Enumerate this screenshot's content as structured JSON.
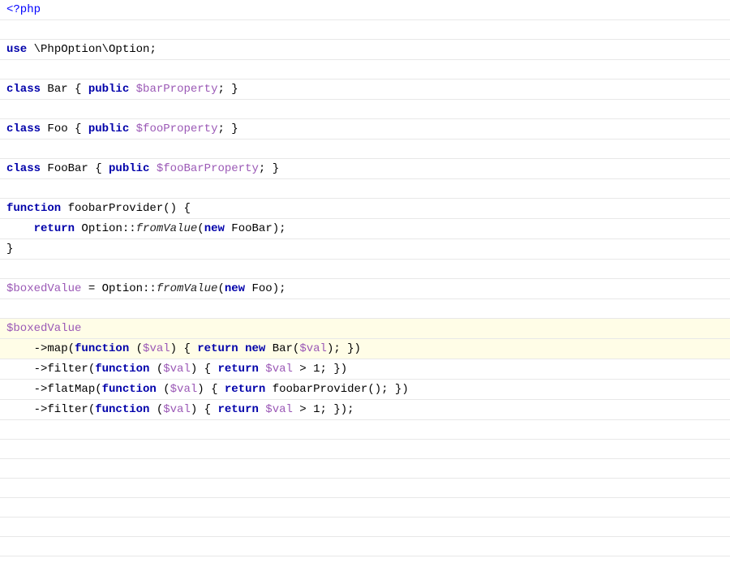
{
  "editor": {
    "lines": [
      {
        "id": 1,
        "type": "normal",
        "content": "php_open"
      },
      {
        "id": 2,
        "type": "empty"
      },
      {
        "id": 3,
        "type": "use_statement"
      },
      {
        "id": 4,
        "type": "empty"
      },
      {
        "id": 5,
        "type": "class_bar"
      },
      {
        "id": 6,
        "type": "empty"
      },
      {
        "id": 7,
        "type": "class_foo"
      },
      {
        "id": 8,
        "type": "empty"
      },
      {
        "id": 9,
        "type": "class_foobar"
      },
      {
        "id": 10,
        "type": "empty"
      },
      {
        "id": 11,
        "type": "fn_foobar_open"
      },
      {
        "id": 12,
        "type": "fn_return"
      },
      {
        "id": 13,
        "type": "fn_close"
      },
      {
        "id": 14,
        "type": "empty"
      },
      {
        "id": 15,
        "type": "boxed_assign"
      },
      {
        "id": 16,
        "type": "empty"
      },
      {
        "id": 17,
        "type": "boxed_map",
        "highlighted": true
      },
      {
        "id": 18,
        "type": "boxed_filter1"
      },
      {
        "id": 19,
        "type": "boxed_flatmap"
      },
      {
        "id": 20,
        "type": "boxed_filter2"
      },
      {
        "id": 21,
        "type": "empty"
      },
      {
        "id": 22,
        "type": "empty"
      },
      {
        "id": 23,
        "type": "empty"
      }
    ]
  }
}
